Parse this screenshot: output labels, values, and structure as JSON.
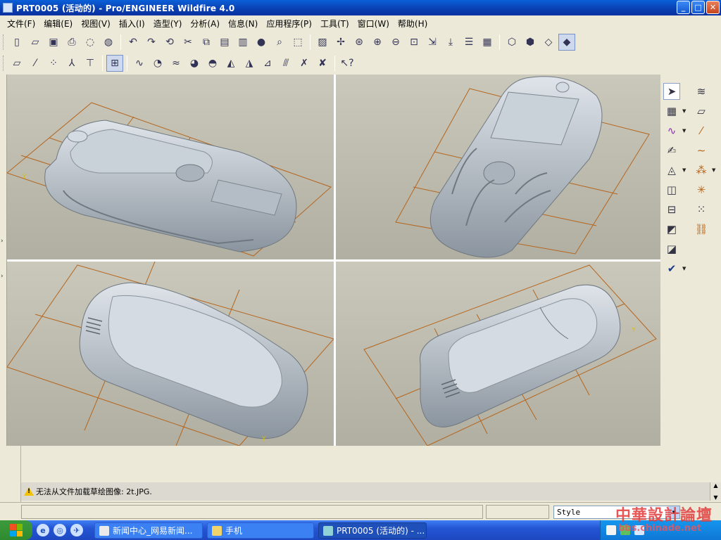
{
  "window": {
    "title": "PRT0005 (活动的) - Pro/ENGINEER Wildfire 4.0",
    "buttons": [
      "_",
      "□",
      "✕"
    ]
  },
  "menu": [
    "文件(F)",
    "编辑(E)",
    "视图(V)",
    "插入(I)",
    "造型(Y)",
    "分析(A)",
    "信息(N)",
    "应用程序(P)",
    "工具(T)",
    "窗口(W)",
    "帮助(H)"
  ],
  "toolbar1": {
    "groups": [
      [
        "new-icon",
        "open-icon",
        "save-icon",
        "print-icon",
        "send-icon",
        "email-icon"
      ],
      [
        "undo-icon",
        "redo-icon",
        "regenerate-icon",
        "cut-icon",
        "copy-icon",
        "paste-icon",
        "paste-special-icon",
        "traffic-light-icon",
        "find-icon",
        "select-box-icon"
      ],
      [
        "repaint-icon",
        "spin-center-icon",
        "orient-mode-icon",
        "zoom-in-icon",
        "zoom-out-icon",
        "refit-icon",
        "reorient-icon",
        "saved-views-icon",
        "layers-icon",
        "view-manager-icon"
      ],
      [
        "wireframe-icon",
        "hidden-line-icon",
        "no-hidden-icon",
        "shading-icon"
      ]
    ]
  },
  "toolbar2": {
    "icons": [
      "datum-plane-display-icon",
      "datum-axis-display-icon",
      "datum-point-display-icon",
      "coordinate-system-display-icon",
      "annotation-display-icon",
      "sketch-grid-icon",
      "curvature-analysis-icon",
      "section-analysis-icon",
      "offset-analysis-icon",
      "gaussian-curvature-icon",
      "draft-analysis-icon",
      "slope-analysis-icon",
      "reflection-analysis-icon",
      "dihedral-icon",
      "curve-network-icon",
      "delete-analysis-icon",
      "delete-all-icon",
      "whats-this-icon"
    ]
  },
  "right_toolbar": {
    "icons": [
      "select-arrow-icon",
      "curve-analysis-icon",
      "datum-plane-icon",
      "plane-icon",
      "curve-icon",
      "axis-icon",
      "curve-from-surface-icon",
      "spline-icon",
      "edit-curve-icon",
      "boundary-surface-icon",
      "point-icon",
      "surface-icon",
      "surface-connect-icon",
      "trim-icon",
      "surface-edit-icon",
      "done-icon"
    ]
  },
  "message": {
    "text": "无法从文件加载草绘图像: 2t.JPG."
  },
  "statusbar": {
    "filter_value": "Style"
  },
  "taskbar": {
    "tasks": [
      {
        "label": "新闻中心_网易新闻..."
      },
      {
        "label": "手机"
      },
      {
        "label": "PRT0005 (活动的) - ..."
      }
    ]
  },
  "watermark": {
    "title": "中華設計論壇",
    "url": "bbs.chinade.net"
  },
  "colors": {
    "viewport_bg": "#c3c1b3",
    "datum_lines": "#b5651d",
    "part_body": "#b9c2cb",
    "titlebar": "#0a4fc8"
  }
}
